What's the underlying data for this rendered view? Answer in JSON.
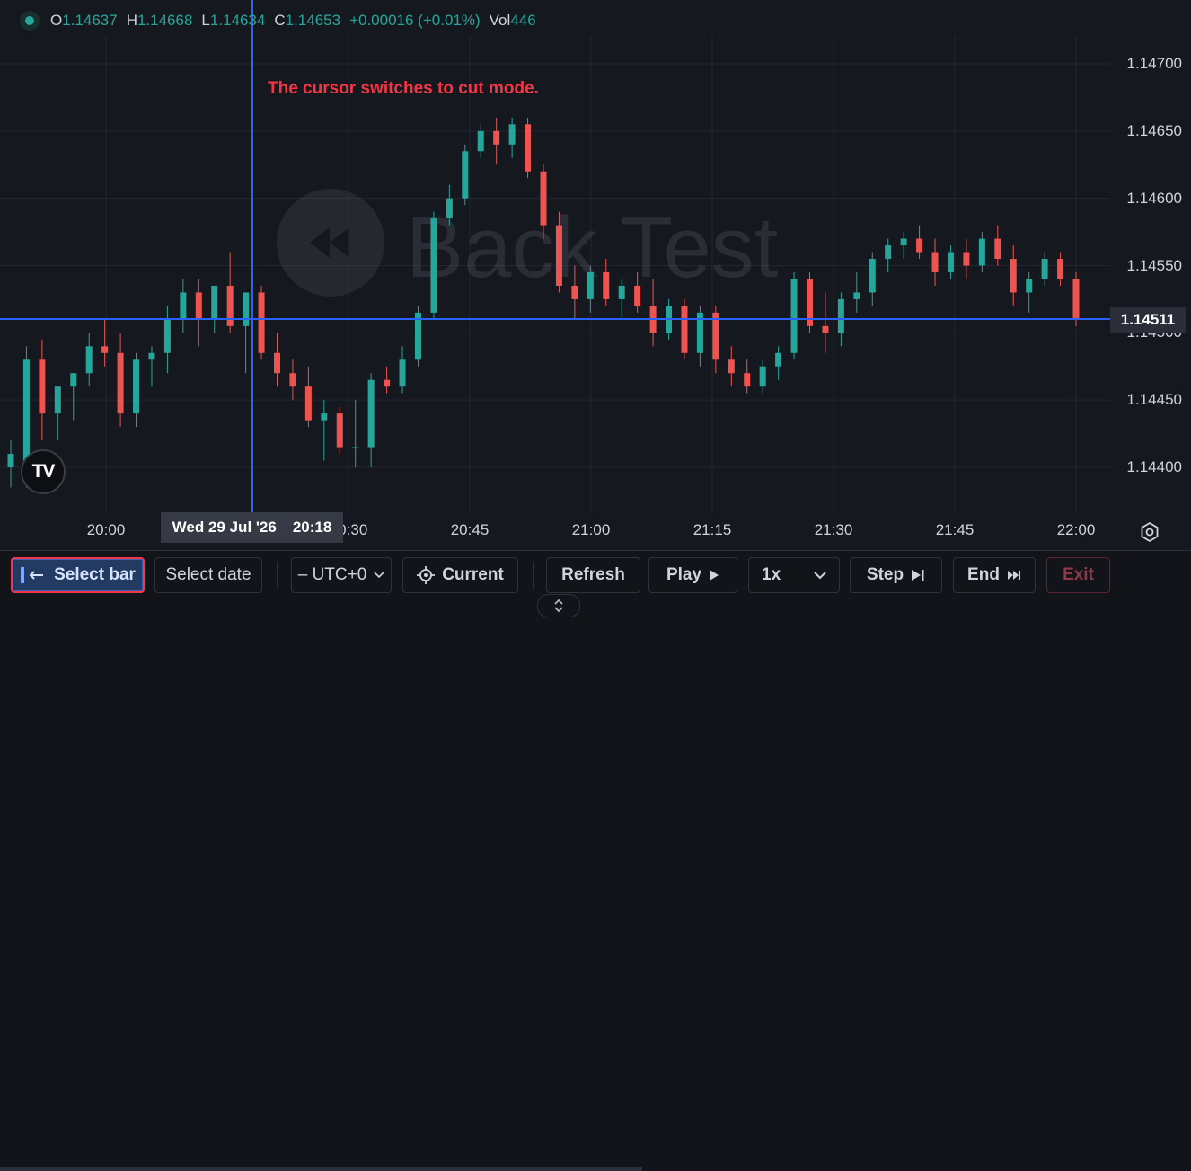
{
  "ohlc": {
    "open_label": "O",
    "open": "1.14637",
    "high_label": "H",
    "high": "1.14668",
    "low_label": "L",
    "low": "1.14634",
    "close_label": "C",
    "close": "1.14653",
    "change": "+0.00016 (+0.01%)",
    "vol_label": "Vol",
    "vol": "446"
  },
  "annotation": "The cursor switches to cut mode.",
  "watermark": "Back Test",
  "price_axis": [
    "1.14700",
    "1.14650",
    "1.14600",
    "1.14550",
    "1.14500",
    "1.14450",
    "1.14400"
  ],
  "time_axis": [
    "20:00",
    "20:30",
    "20:45",
    "21:00",
    "21:15",
    "21:30",
    "21:45",
    "22:00"
  ],
  "current_price": "1.14511",
  "crosshair": {
    "date": "Wed 29 Jul '26",
    "time": "20:18"
  },
  "logo": "TV",
  "colors": {
    "up": "#26a69a",
    "down": "#ef5350",
    "crosshair": "#2962ff",
    "background": "#161820"
  },
  "toolbar": {
    "select_bar": "Select bar",
    "select_date": "Select date",
    "timezone": "– UTC+0",
    "current": "Current",
    "refresh": "Refresh",
    "play": "Play",
    "speed": "1x",
    "step": "Step",
    "end": "End",
    "exit": "Exit"
  },
  "chart_data": {
    "type": "candlestick",
    "x_label": "",
    "y_label": "",
    "ylim": [
      1.1438,
      1.1472
    ],
    "candles": [
      {
        "o": 1.144,
        "h": 1.1442,
        "l": 1.14385,
        "c": 1.1441
      },
      {
        "o": 1.14395,
        "h": 1.1449,
        "l": 1.14385,
        "c": 1.1448
      },
      {
        "o": 1.1448,
        "h": 1.14495,
        "l": 1.1442,
        "c": 1.1444
      },
      {
        "o": 1.1444,
        "h": 1.1446,
        "l": 1.1442,
        "c": 1.1446
      },
      {
        "o": 1.1446,
        "h": 1.1447,
        "l": 1.14435,
        "c": 1.1447
      },
      {
        "o": 1.1447,
        "h": 1.145,
        "l": 1.1446,
        "c": 1.1449
      },
      {
        "o": 1.1449,
        "h": 1.1451,
        "l": 1.14475,
        "c": 1.14485
      },
      {
        "o": 1.14485,
        "h": 1.145,
        "l": 1.1443,
        "c": 1.1444
      },
      {
        "o": 1.1444,
        "h": 1.14485,
        "l": 1.1443,
        "c": 1.1448
      },
      {
        "o": 1.1448,
        "h": 1.1449,
        "l": 1.1446,
        "c": 1.14485
      },
      {
        "o": 1.14485,
        "h": 1.1452,
        "l": 1.1447,
        "c": 1.1451
      },
      {
        "o": 1.1451,
        "h": 1.1454,
        "l": 1.145,
        "c": 1.1453
      },
      {
        "o": 1.1453,
        "h": 1.1454,
        "l": 1.1449,
        "c": 1.1451
      },
      {
        "o": 1.1451,
        "h": 1.14535,
        "l": 1.145,
        "c": 1.14535
      },
      {
        "o": 1.14535,
        "h": 1.1456,
        "l": 1.145,
        "c": 1.14505
      },
      {
        "o": 1.14505,
        "h": 1.1453,
        "l": 1.1447,
        "c": 1.1453
      },
      {
        "o": 1.1453,
        "h": 1.14535,
        "l": 1.1448,
        "c": 1.14485
      },
      {
        "o": 1.14485,
        "h": 1.145,
        "l": 1.1446,
        "c": 1.1447
      },
      {
        "o": 1.1447,
        "h": 1.1448,
        "l": 1.1445,
        "c": 1.1446
      },
      {
        "o": 1.1446,
        "h": 1.14475,
        "l": 1.1443,
        "c": 1.14435
      },
      {
        "o": 1.14435,
        "h": 1.1445,
        "l": 1.14405,
        "c": 1.1444
      },
      {
        "o": 1.1444,
        "h": 1.14445,
        "l": 1.1441,
        "c": 1.14415
      },
      {
        "o": 1.14415,
        "h": 1.1445,
        "l": 1.144,
        "c": 1.14415
      },
      {
        "o": 1.14415,
        "h": 1.1447,
        "l": 1.144,
        "c": 1.14465
      },
      {
        "o": 1.14465,
        "h": 1.14475,
        "l": 1.14455,
        "c": 1.1446
      },
      {
        "o": 1.1446,
        "h": 1.1449,
        "l": 1.14455,
        "c": 1.1448
      },
      {
        "o": 1.1448,
        "h": 1.1452,
        "l": 1.14475,
        "c": 1.14515
      },
      {
        "o": 1.14515,
        "h": 1.1459,
        "l": 1.1451,
        "c": 1.14585
      },
      {
        "o": 1.14585,
        "h": 1.1461,
        "l": 1.1458,
        "c": 1.146
      },
      {
        "o": 1.146,
        "h": 1.1464,
        "l": 1.14595,
        "c": 1.14635
      },
      {
        "o": 1.14635,
        "h": 1.14655,
        "l": 1.1463,
        "c": 1.1465
      },
      {
        "o": 1.1465,
        "h": 1.1466,
        "l": 1.14625,
        "c": 1.1464
      },
      {
        "o": 1.1464,
        "h": 1.1466,
        "l": 1.1463,
        "c": 1.14655
      },
      {
        "o": 1.14655,
        "h": 1.1466,
        "l": 1.14615,
        "c": 1.1462
      },
      {
        "o": 1.1462,
        "h": 1.14625,
        "l": 1.1457,
        "c": 1.1458
      },
      {
        "o": 1.1458,
        "h": 1.1459,
        "l": 1.1453,
        "c": 1.14535
      },
      {
        "o": 1.14535,
        "h": 1.1455,
        "l": 1.1451,
        "c": 1.14525
      },
      {
        "o": 1.14525,
        "h": 1.1455,
        "l": 1.14515,
        "c": 1.14545
      },
      {
        "o": 1.14545,
        "h": 1.14555,
        "l": 1.1452,
        "c": 1.14525
      },
      {
        "o": 1.14525,
        "h": 1.1454,
        "l": 1.1451,
        "c": 1.14535
      },
      {
        "o": 1.14535,
        "h": 1.14545,
        "l": 1.14515,
        "c": 1.1452
      },
      {
        "o": 1.1452,
        "h": 1.1454,
        "l": 1.1449,
        "c": 1.145
      },
      {
        "o": 1.145,
        "h": 1.14525,
        "l": 1.14495,
        "c": 1.1452
      },
      {
        "o": 1.1452,
        "h": 1.14525,
        "l": 1.1448,
        "c": 1.14485
      },
      {
        "o": 1.14485,
        "h": 1.1452,
        "l": 1.14475,
        "c": 1.14515
      },
      {
        "o": 1.14515,
        "h": 1.1452,
        "l": 1.1447,
        "c": 1.1448
      },
      {
        "o": 1.1448,
        "h": 1.1449,
        "l": 1.1446,
        "c": 1.1447
      },
      {
        "o": 1.1447,
        "h": 1.1448,
        "l": 1.14455,
        "c": 1.1446
      },
      {
        "o": 1.1446,
        "h": 1.1448,
        "l": 1.14455,
        "c": 1.14475
      },
      {
        "o": 1.14475,
        "h": 1.1449,
        "l": 1.14465,
        "c": 1.14485
      },
      {
        "o": 1.14485,
        "h": 1.14545,
        "l": 1.1448,
        "c": 1.1454
      },
      {
        "o": 1.1454,
        "h": 1.14545,
        "l": 1.145,
        "c": 1.14505
      },
      {
        "o": 1.14505,
        "h": 1.1453,
        "l": 1.14485,
        "c": 1.145
      },
      {
        "o": 1.145,
        "h": 1.1453,
        "l": 1.1449,
        "c": 1.14525
      },
      {
        "o": 1.14525,
        "h": 1.14545,
        "l": 1.14515,
        "c": 1.1453
      },
      {
        "o": 1.1453,
        "h": 1.1456,
        "l": 1.1452,
        "c": 1.14555
      },
      {
        "o": 1.14555,
        "h": 1.1457,
        "l": 1.14545,
        "c": 1.14565
      },
      {
        "o": 1.14565,
        "h": 1.14575,
        "l": 1.14555,
        "c": 1.1457
      },
      {
        "o": 1.1457,
        "h": 1.1458,
        "l": 1.14555,
        "c": 1.1456
      },
      {
        "o": 1.1456,
        "h": 1.1457,
        "l": 1.14535,
        "c": 1.14545
      },
      {
        "o": 1.14545,
        "h": 1.14565,
        "l": 1.1454,
        "c": 1.1456
      },
      {
        "o": 1.1456,
        "h": 1.1457,
        "l": 1.1454,
        "c": 1.1455
      },
      {
        "o": 1.1455,
        "h": 1.14575,
        "l": 1.14545,
        "c": 1.1457
      },
      {
        "o": 1.1457,
        "h": 1.1458,
        "l": 1.1455,
        "c": 1.14555
      },
      {
        "o": 1.14555,
        "h": 1.14565,
        "l": 1.1452,
        "c": 1.1453
      },
      {
        "o": 1.1453,
        "h": 1.14545,
        "l": 1.14515,
        "c": 1.1454
      },
      {
        "o": 1.1454,
        "h": 1.1456,
        "l": 1.14535,
        "c": 1.14555
      },
      {
        "o": 1.14555,
        "h": 1.1456,
        "l": 1.14535,
        "c": 1.1454
      },
      {
        "o": 1.1454,
        "h": 1.14545,
        "l": 1.14505,
        "c": 1.1451
      }
    ]
  }
}
